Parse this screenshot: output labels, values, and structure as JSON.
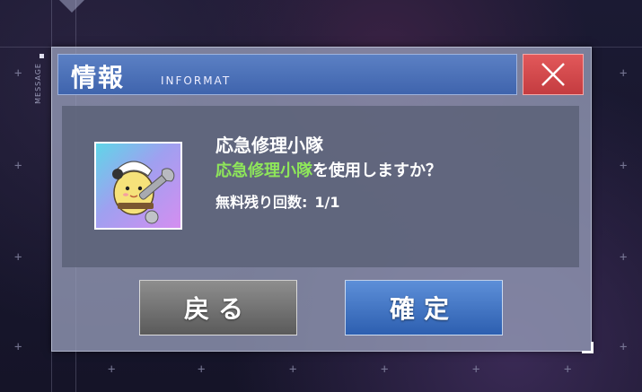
{
  "side_label": "MESSAGE",
  "dialog": {
    "title_jp": "情報",
    "title_en": "INFORMAT",
    "item_name": "応急修理小隊",
    "confirm_highlight": "応急修理小隊",
    "confirm_rest": "を使用しますか？",
    "free_label": "無料残り回数:",
    "free_value": "1/1",
    "back_label": "戻る",
    "ok_label": "確定"
  },
  "colors": {
    "title_bar": "#4a6fb8",
    "close_button": "#d44a4d",
    "highlight": "#8ee65a",
    "ok_button": "#3a6ec0",
    "back_button": "#707070"
  },
  "icons": {
    "close": "close-x-icon",
    "item": "repair-fairy-wrench-icon"
  }
}
